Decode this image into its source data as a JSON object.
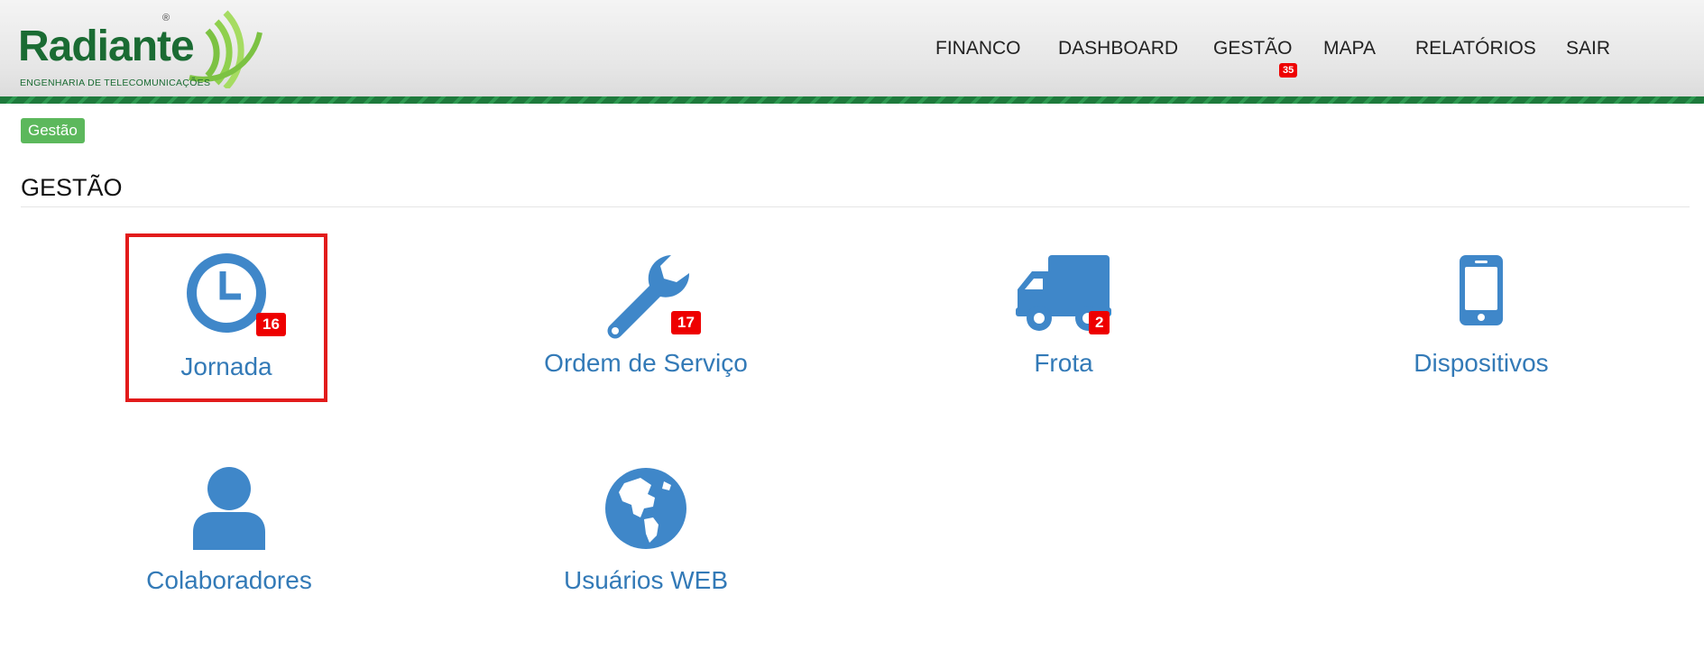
{
  "brand": {
    "name": "Radiante",
    "tagline": "ENGENHARIA DE TELECOMUNICAÇÕES",
    "registered_mark": "®",
    "color": "#1a6b33"
  },
  "nav": {
    "items": [
      {
        "label": "FINANCO"
      },
      {
        "label": "DASHBOARD"
      },
      {
        "label": "GESTÃO",
        "badge": "35"
      },
      {
        "label": "MAPA"
      },
      {
        "label": "RELATÓRIOS"
      },
      {
        "label": "SAIR"
      }
    ]
  },
  "breadcrumb": {
    "label": "Gestão"
  },
  "page": {
    "title": "GESTÃO"
  },
  "tiles": [
    {
      "label": "Jornada",
      "icon": "clock-icon",
      "badge": "16",
      "selected": true
    },
    {
      "label": "Ordem de Serviço",
      "icon": "wrench-icon",
      "badge": "17"
    },
    {
      "label": "Frota",
      "icon": "truck-icon",
      "badge": "2"
    },
    {
      "label": "Dispositivos",
      "icon": "mobile-phone-icon"
    },
    {
      "label": "Colaboradores",
      "icon": "user-icon"
    },
    {
      "label": "Usuários WEB",
      "icon": "globe-icon"
    }
  ],
  "colors": {
    "accent": "#337ab7",
    "icon": "#3f87c9",
    "badge": "#ee0000",
    "breadcrumb": "#5cb85c",
    "selection": "#e21b1b"
  }
}
